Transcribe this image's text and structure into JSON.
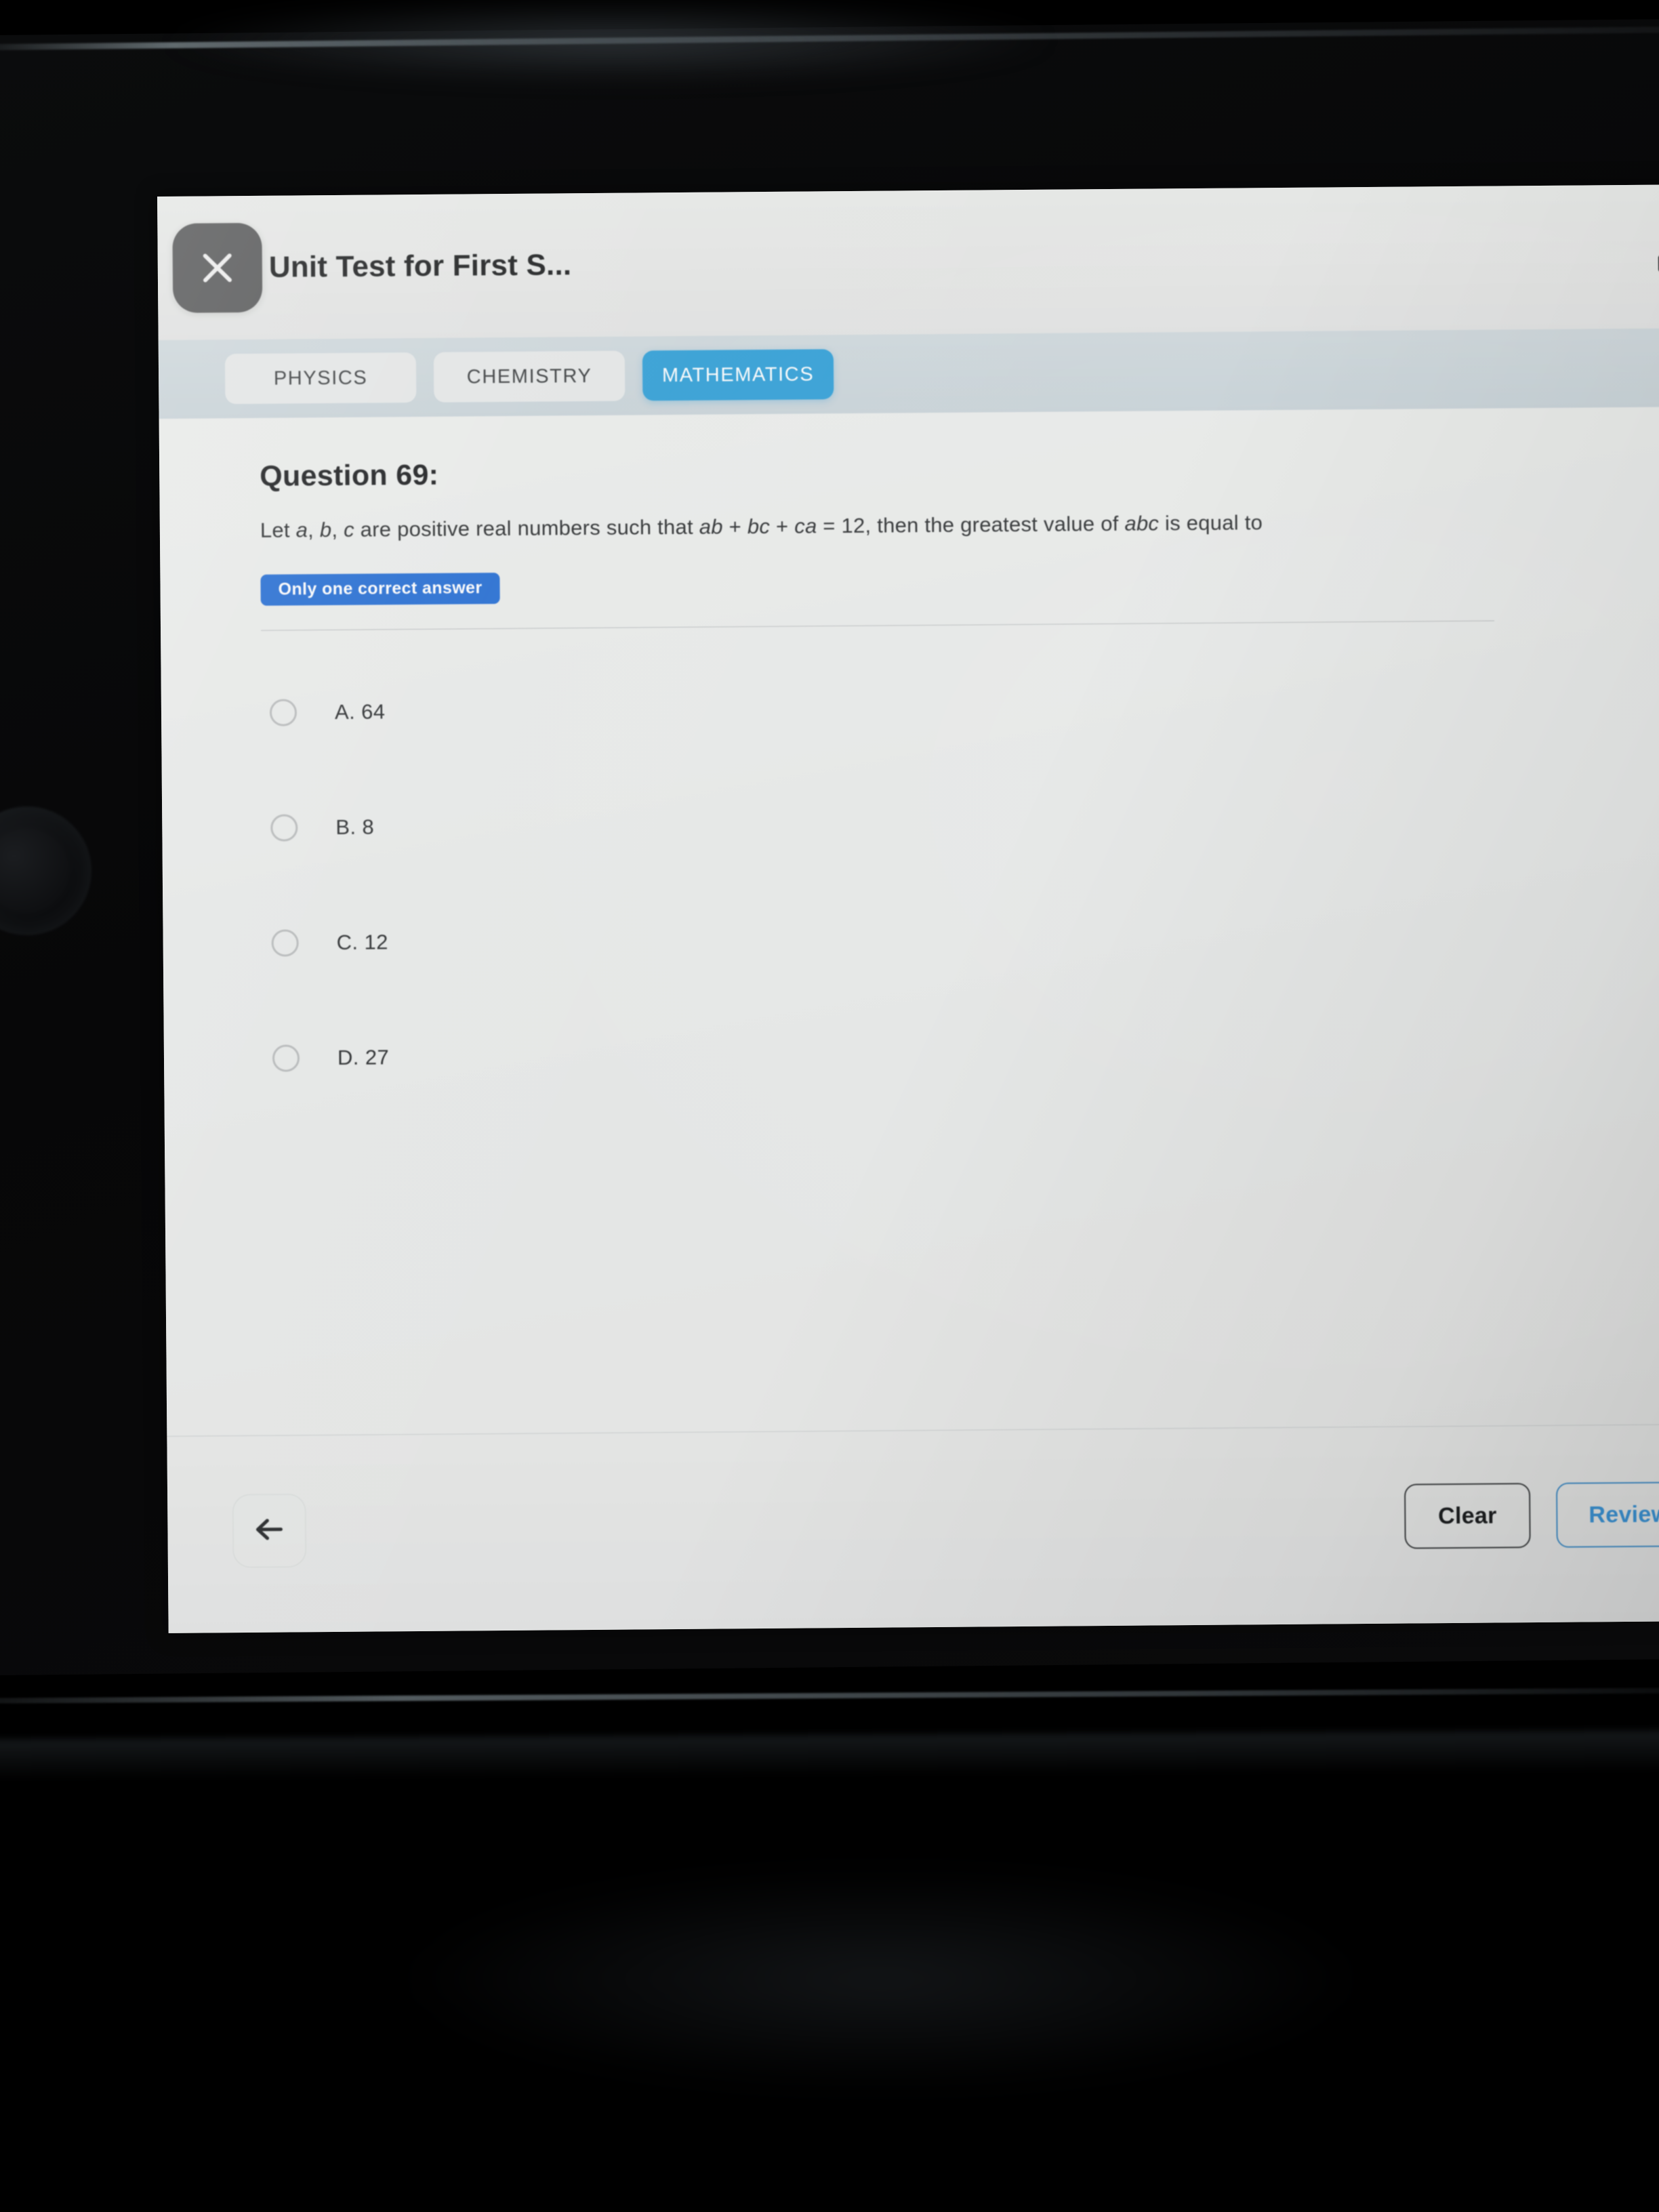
{
  "header": {
    "close_icon": "close-x-icon",
    "title": "Unit Test for First S...",
    "right_clipped_glyph": "C"
  },
  "tabs": [
    {
      "label": "PHYSICS",
      "active": false
    },
    {
      "label": "CHEMISTRY",
      "active": false
    },
    {
      "label": "MATHEMATICS",
      "active": true
    }
  ],
  "question": {
    "number_label": "Question 69:",
    "text_parts": [
      {
        "text": "Let ",
        "italic": false
      },
      {
        "text": "a",
        "italic": true
      },
      {
        "text": ", ",
        "italic": false
      },
      {
        "text": "b",
        "italic": true
      },
      {
        "text": ", ",
        "italic": false
      },
      {
        "text": "c",
        "italic": true
      },
      {
        "text": " are positive real numbers such that ",
        "italic": false
      },
      {
        "text": "ab",
        "italic": true
      },
      {
        "text": " + ",
        "italic": false
      },
      {
        "text": "bc",
        "italic": true
      },
      {
        "text": " + ",
        "italic": false
      },
      {
        "text": "ca",
        "italic": true
      },
      {
        "text": " = 12, then the greatest value of ",
        "italic": false
      },
      {
        "text": "abc",
        "italic": true
      },
      {
        "text": " is equal to",
        "italic": false
      }
    ],
    "text_plain": "Let a, b, c are positive real numbers such that ab + bc + ca = 12, then the greatest value of abc is equal to",
    "badge": "Only one correct answer",
    "options": [
      {
        "label": "A. 64",
        "selected": false
      },
      {
        "label": "B. 8",
        "selected": false
      },
      {
        "label": "C. 12",
        "selected": false
      },
      {
        "label": "D. 27",
        "selected": false
      }
    ]
  },
  "footer": {
    "back_icon": "back-arrow-icon",
    "clear_label": "Clear",
    "review_label": "Review"
  },
  "colors": {
    "accent_blue": "#2aa3e0",
    "badge_blue": "#1f6fe0",
    "review_blue": "#2f93de",
    "screen_bg": "#eceeec",
    "tabstrip_bg": "#ccd7dd",
    "close_btn_gray": "#58595a"
  }
}
